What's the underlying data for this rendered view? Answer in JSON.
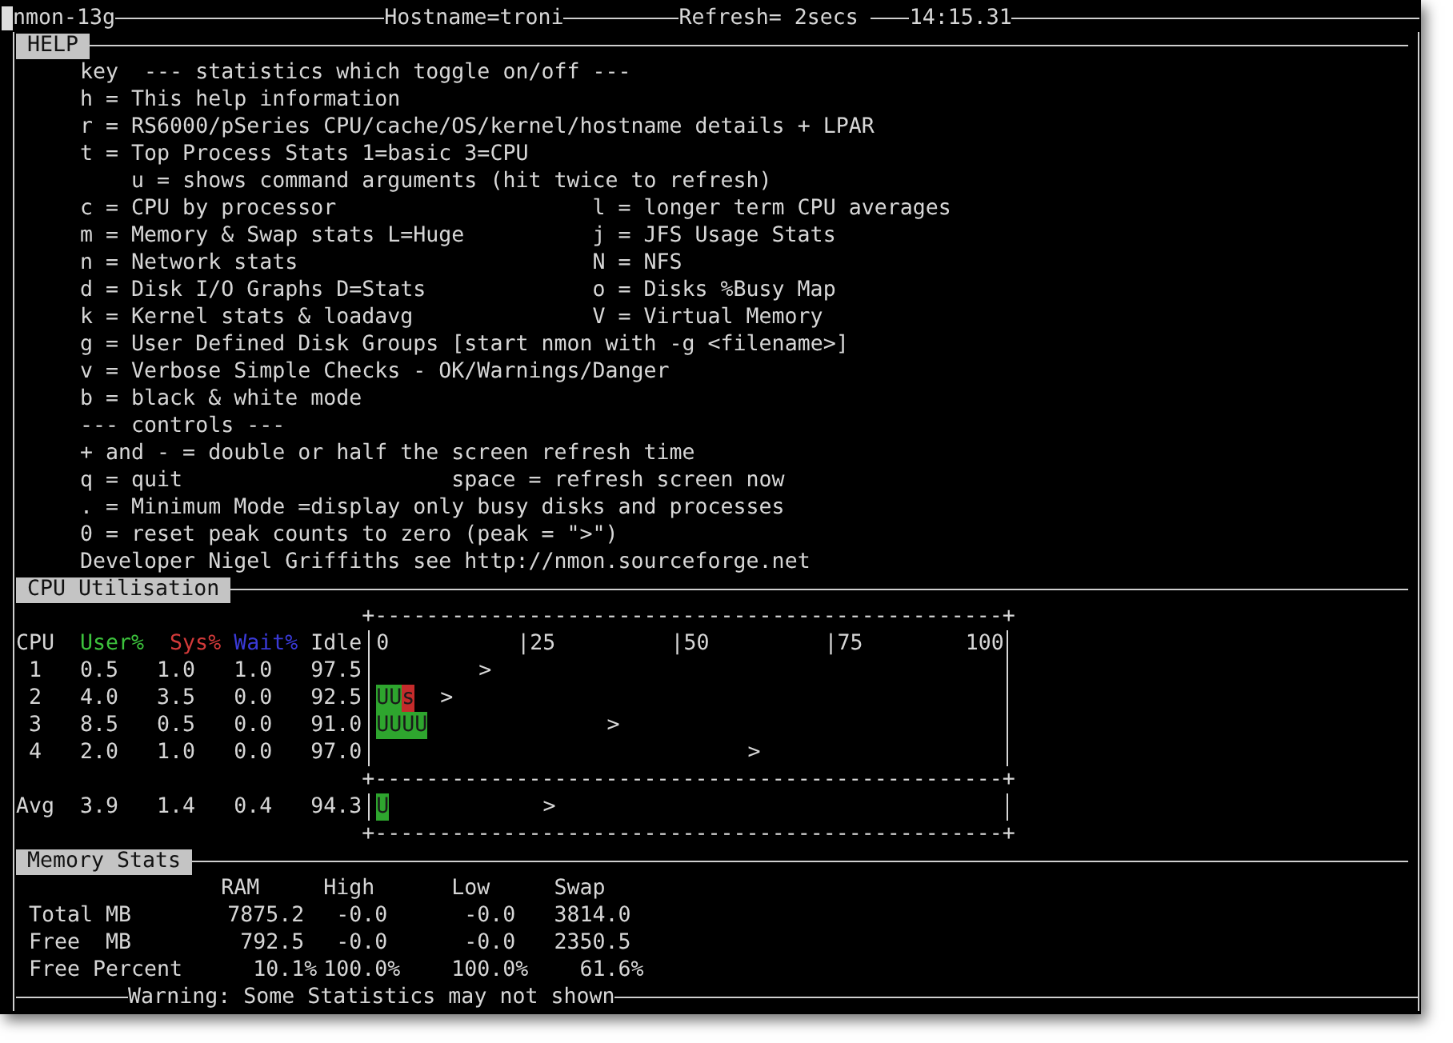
{
  "title_bar": {
    "program": "nmon-13g",
    "hostname": "Hostname=troni",
    "refresh": "Refresh= 2secs",
    "time": "14:15.31"
  },
  "help": {
    "title": "HELP",
    "lines": [
      {
        "kind": "single",
        "text": "key  --- statistics which toggle on/off ---"
      },
      {
        "kind": "single",
        "text": "h = This help information"
      },
      {
        "kind": "single",
        "text": "r = RS6000/pSeries CPU/cache/OS/kernel/hostname details + LPAR"
      },
      {
        "kind": "single",
        "text": "t = Top Process Stats 1=basic 3=CPU",
        "children": [
          {
            "kind": "single",
            "text": "u = shows command arguments (hit twice to refresh)"
          }
        ]
      },
      {
        "kind": "wide",
        "text": "c = CPU by processor",
        "right": "l = longer term CPU averages"
      },
      {
        "kind": "wide",
        "text": "m = Memory & Swap stats L=Huge",
        "right": "j = JFS Usage Stats"
      },
      {
        "kind": "wide",
        "text": "n = Network stats",
        "right": "N = NFS"
      },
      {
        "kind": "wide",
        "text": "d = Disk I/O Graphs D=Stats",
        "right": "o = Disks %Busy Map"
      },
      {
        "kind": "wide",
        "text": "k = Kernel stats & loadavg",
        "right": "V = Virtual Memory"
      },
      {
        "kind": "single",
        "text": "g = User Defined Disk Groups [start nmon with -g <filename>]"
      },
      {
        "kind": "single",
        "text": "v = Verbose Simple Checks - OK/Warnings/Danger"
      },
      {
        "kind": "single",
        "text": "b = black & white mode"
      },
      {
        "kind": "single",
        "text": "--- controls ---"
      },
      {
        "kind": "single",
        "text": "+ and - = double or half the screen refresh time"
      },
      {
        "kind": "narrow",
        "text": "q = quit",
        "right": "space = refresh screen now"
      },
      {
        "kind": "single",
        "text": ". = Minimum Mode =display only busy disks and processes"
      },
      {
        "kind": "single",
        "text": "0 = reset peak counts to zero (peak = \">\")"
      },
      {
        "kind": "single",
        "text": "Developer Nigel Griffiths see http://nmon.sourceforge.net"
      }
    ]
  },
  "cpu": {
    "title": "CPU Utilisation",
    "frame_top": "+-------------------------------------------------+",
    "columns": [
      "CPU",
      "User%",
      "Sys%",
      "Wait%",
      "Idle"
    ],
    "scale": "0          |25         |50         |75        100",
    "rows": [
      {
        "kind": "cpu",
        "cpu": "1",
        "user": "0.5",
        "sys": "1.0",
        "wait": "1.0",
        "idle": "97.5",
        "bar": [
          {
            "kind": "peak",
            "text": "        >"
          }
        ]
      },
      {
        "kind": "cpu",
        "cpu": "2",
        "user": "4.0",
        "sys": "3.5",
        "wait": "0.0",
        "idle": "92.5",
        "bar": [
          {
            "kind": "user",
            "text": "UU"
          },
          {
            "kind": "sys",
            "text": "s"
          },
          {
            "kind": "peak",
            "text": "  >"
          }
        ]
      },
      {
        "kind": "cpu",
        "cpu": "3",
        "user": "8.5",
        "sys": "0.5",
        "wait": "0.0",
        "idle": "91.0",
        "bar": [
          {
            "kind": "user",
            "text": "UUUU"
          },
          {
            "kind": "peak",
            "text": "              >"
          }
        ]
      },
      {
        "kind": "cpu",
        "cpu": "4",
        "user": "2.0",
        "sys": "1.0",
        "wait": "0.0",
        "idle": "97.0",
        "bar": [
          {
            "kind": "peak",
            "text": "                             >"
          }
        ]
      }
    ],
    "separator": "+-------------------------------------------------+",
    "average": {
      "kind": "average",
      "cpu": "Avg",
      "user": "3.9",
      "sys": "1.4",
      "wait": "0.4",
      "idle": "94.3",
      "bar": [
        {
          "kind": "user",
          "text": "U"
        },
        {
          "kind": "peak",
          "text": "            >"
        }
      ]
    },
    "frame_bottom": "+-------------------------------------------------+"
  },
  "memory": {
    "title": "Memory Stats",
    "columns": [
      "RAM",
      "High",
      "Low",
      "Swap"
    ],
    "rows": [
      {
        "kind": "mb",
        "label": "Total MB",
        "values": [
          "7875.2",
          "-0.0",
          "-0.0",
          "3814.0"
        ]
      },
      {
        "kind": "mb",
        "label": "Free  MB",
        "values": [
          "792.5",
          "-0.0",
          "-0.0",
          "2350.5"
        ]
      },
      {
        "kind": "percent",
        "label": "Free Percent",
        "values": [
          "10.1%",
          "100.0%",
          "100.0%",
          "61.6%"
        ]
      }
    ]
  },
  "footer": "Warning: Some Statistics may not shown"
}
